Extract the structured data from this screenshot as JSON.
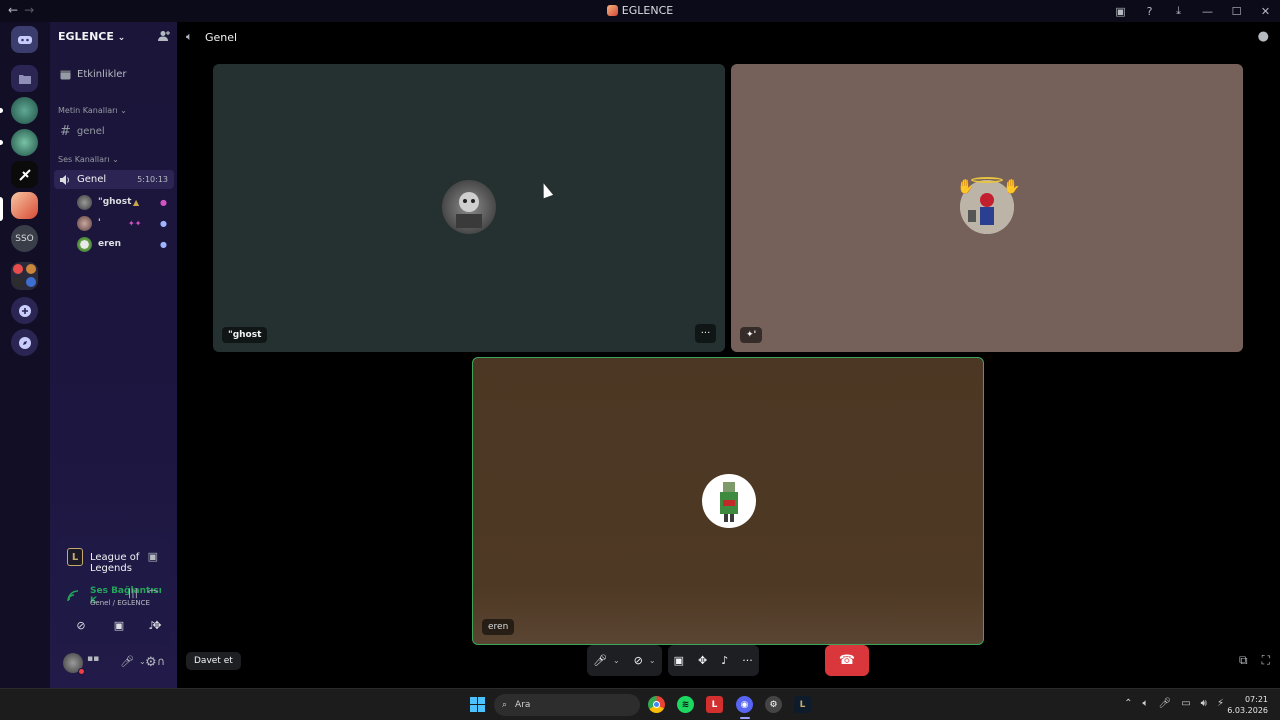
{
  "window": {
    "title": "EGLENCE",
    "nav_back": "←",
    "nav_forward": "→",
    "buttons": [
      "inbox",
      "help",
      "download",
      "minimize",
      "maximize",
      "close"
    ]
  },
  "guilds": {
    "items": [
      {
        "name": "direct-messages"
      },
      {
        "name": "folder"
      },
      {
        "name": "server-1"
      },
      {
        "name": "server-2"
      },
      {
        "name": "server-3"
      },
      {
        "name": "server-eglence",
        "selected": true
      },
      {
        "name": "server-sso",
        "label": "SSO"
      },
      {
        "name": "server-folder"
      },
      {
        "name": "add-server"
      },
      {
        "name": "explore"
      }
    ]
  },
  "server": {
    "name": "EGLENCE",
    "chevron": "⌄",
    "events_label": "Etkinlikler",
    "text_category": "Metin Kanalları",
    "text_channel": "genel",
    "voice_category": "Ses Kanalları",
    "voice_channel": "Genel",
    "voice_timer": "5:10:13",
    "voice_users": [
      {
        "name": "\"ghost",
        "status": "streaming"
      },
      {
        "name": "'",
        "status": "deafened"
      },
      {
        "name": "eren",
        "status": "muted"
      }
    ]
  },
  "activity": {
    "game": "League of Legends"
  },
  "rtc": {
    "status": "Ses Bağlantısı K",
    "location": "Genel / EGLENCE"
  },
  "topbar": {
    "channel_name": "Genel"
  },
  "tiles": [
    {
      "name": "\"ghost",
      "color": "#243130"
    },
    {
      "name": "'",
      "color": "#75615a"
    },
    {
      "name": "eren",
      "color": "#4e3925"
    }
  ],
  "bottom": {
    "invite_label": "Davet et",
    "more_label": "···"
  },
  "taskbar": {
    "search_placeholder": "Ara",
    "time": "07:21",
    "date": "6.03.2026"
  },
  "colors": {
    "accent_green": "#23a55a",
    "hangup_red": "#da373c",
    "sidebar_bg": "#1b1539"
  }
}
